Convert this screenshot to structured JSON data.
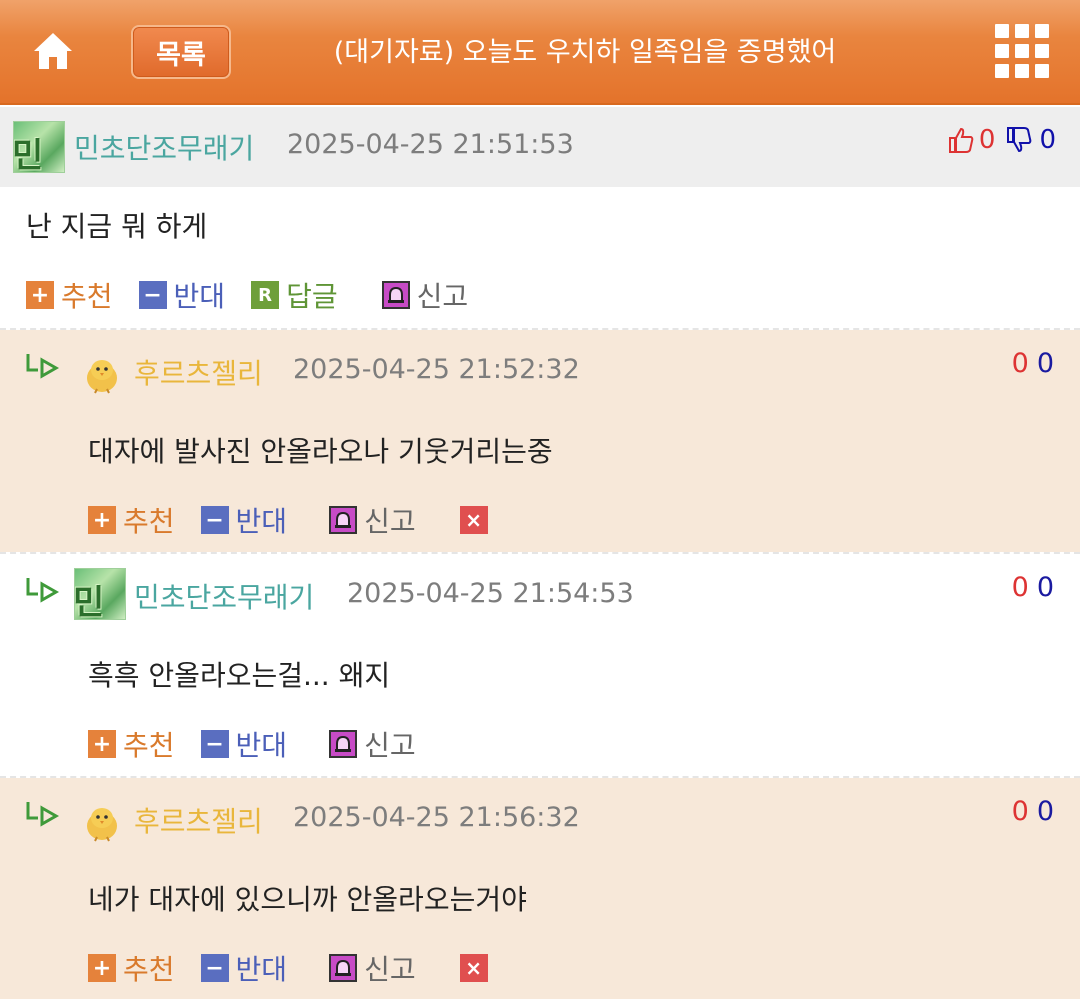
{
  "header": {
    "list_label": "목록",
    "title": "(대기자료) 오늘도 우치하 일족임을 증명했어"
  },
  "actions": {
    "recommend": "추천",
    "oppose": "반대",
    "reply": "답글",
    "report": "신고",
    "plus_glyph": "+",
    "minus_glyph": "−",
    "reply_glyph": "R",
    "delete_glyph": "×"
  },
  "avatar_text": "민초",
  "comments": [
    {
      "nick": "민초단조무래기",
      "time": "2025-04-25 21:51:53",
      "text": "난 지금 뭐 하게",
      "up": "0",
      "down": "0"
    },
    {
      "nick": "후르츠젤리",
      "time": "2025-04-25 21:52:32",
      "text": "대자에 발사진 안올라오나 기웃거리는중",
      "up": "0",
      "down": "0"
    },
    {
      "nick": "민초단조무래기",
      "time": "2025-04-25 21:54:53",
      "text": "흑흑 안올라오는걸... 왜지",
      "up": "0",
      "down": "0"
    },
    {
      "nick": "후르츠젤리",
      "time": "2025-04-25 21:56:32",
      "text": "네가 대자에 있으니까 안올라오는거야",
      "up": "0",
      "down": "0"
    }
  ]
}
